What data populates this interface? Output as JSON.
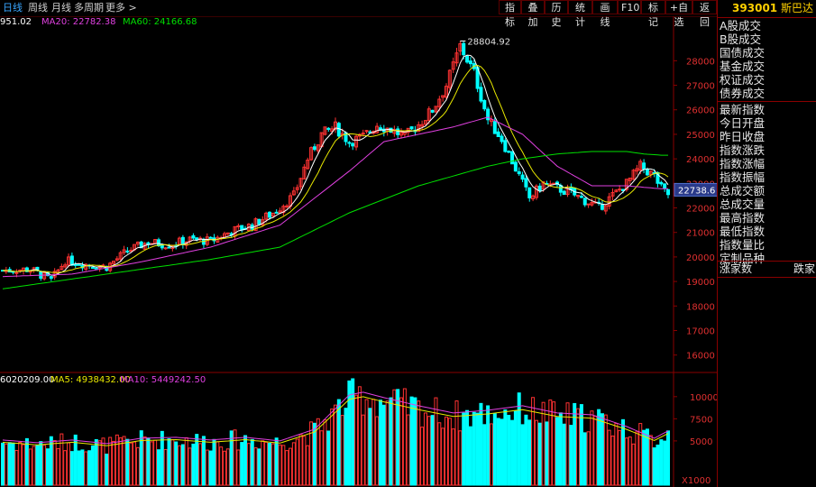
{
  "toolbar": {
    "periods": [
      "日线",
      "周线",
      "月线",
      "多周期",
      "更多 >"
    ],
    "tools": [
      "指标",
      "叠加",
      "历史",
      "统计",
      "画线",
      "F10",
      "标记",
      "+自选",
      "返回"
    ]
  },
  "indicators": {
    "price_line": [
      {
        "label": "951.02",
        "color": "#ffffff"
      },
      {
        "label": "MA20: 22782.38",
        "color": "#e040e0"
      },
      {
        "label": "MA60: 24166.68",
        "color": "#00e000"
      }
    ],
    "volume_line": [
      {
        "label": "6020209.00",
        "color": "#ffffff"
      },
      {
        "label": "MA5: 4938432.00",
        "color": "#e8e800"
      },
      {
        "label": "MA10: 5449242.50",
        "color": "#e040e0"
      }
    ]
  },
  "right_panel": {
    "code": "393001",
    "name": "斯巴达",
    "items_group1": [
      "A股成交",
      "B股成交",
      "国债成交",
      "基金成交",
      "权证成交",
      "债券成交"
    ],
    "items_group2": [
      "最新指数",
      "今日开盘",
      "昨日收盘",
      "指数涨跌",
      "指数涨幅",
      "指数振幅",
      "总成交额",
      "总成交量",
      "最高指数",
      "最低指数",
      "指数量比",
      "定制品种"
    ],
    "footer_left": "涨家数",
    "footer_right": "跌家"
  },
  "colors": {
    "up": "#ff3232",
    "down": "#00ffff",
    "ma5": "#ffffff",
    "ma10": "#e8e800",
    "ma20": "#e040e0",
    "ma60": "#00e000",
    "axis": "#8a0000",
    "accent": "#38a6ff"
  },
  "chart_data": [
    {
      "type": "candlestick",
      "title": "",
      "y_ticks": [
        16000,
        17000,
        18000,
        19000,
        20000,
        21000,
        22000,
        23000,
        24000,
        25000,
        26000,
        27000,
        28000
      ],
      "ylim": [
        15400,
        29300
      ],
      "annotations": [
        {
          "label": "28804.92",
          "value": 28804.92
        }
      ],
      "current_value_label": "22738.6",
      "current_value": 22738.6,
      "trend_path": [
        [
          0,
          19450
        ],
        [
          8,
          19500
        ],
        [
          14,
          19050
        ],
        [
          18,
          19850
        ],
        [
          24,
          19700
        ],
        [
          30,
          19600
        ],
        [
          36,
          20250
        ],
        [
          42,
          20600
        ],
        [
          48,
          20500
        ],
        [
          54,
          20700
        ],
        [
          60,
          20650
        ],
        [
          66,
          21050
        ],
        [
          72,
          21300
        ],
        [
          78,
          21800
        ],
        [
          84,
          22500
        ],
        [
          88,
          24000
        ],
        [
          92,
          25000
        ],
        [
          96,
          25300
        ],
        [
          100,
          24700
        ],
        [
          104,
          24900
        ],
        [
          108,
          25400
        ],
        [
          112,
          25200
        ],
        [
          116,
          24900
        ],
        [
          120,
          25400
        ],
        [
          124,
          26000
        ],
        [
          128,
          27000
        ],
        [
          132,
          28600
        ],
        [
          136,
          27500
        ],
        [
          140,
          25600
        ],
        [
          144,
          24800
        ],
        [
          148,
          23600
        ],
        [
          152,
          22400
        ],
        [
          156,
          23000
        ],
        [
          160,
          22800
        ],
        [
          164,
          22600
        ],
        [
          168,
          22300
        ],
        [
          172,
          22000
        ],
        [
          176,
          22500
        ],
        [
          180,
          23000
        ],
        [
          184,
          23700
        ],
        [
          188,
          23300
        ],
        [
          190,
          22800
        ],
        [
          192,
          22550
        ]
      ],
      "ma60_path": [
        [
          0,
          18700
        ],
        [
          30,
          19300
        ],
        [
          60,
          19900
        ],
        [
          80,
          20400
        ],
        [
          100,
          21800
        ],
        [
          120,
          22900
        ],
        [
          130,
          23300
        ],
        [
          140,
          23700
        ],
        [
          150,
          24000
        ],
        [
          160,
          24200
        ],
        [
          170,
          24300
        ],
        [
          180,
          24300
        ],
        [
          185,
          24200
        ],
        [
          190,
          24150
        ]
      ],
      "ma20_path": [
        [
          0,
          19200
        ],
        [
          20,
          19300
        ],
        [
          40,
          19800
        ],
        [
          60,
          20400
        ],
        [
          80,
          21300
        ],
        [
          100,
          23500
        ],
        [
          110,
          24700
        ],
        [
          120,
          25000
        ],
        [
          130,
          25300
        ],
        [
          140,
          25700
        ],
        [
          150,
          25000
        ],
        [
          160,
          23700
        ],
        [
          170,
          22900
        ],
        [
          180,
          22900
        ],
        [
          190,
          22780
        ]
      ]
    },
    {
      "type": "bar",
      "title": "",
      "y_ticks": [
        5000,
        7500,
        10000
      ],
      "ylim": [
        0,
        11000
      ],
      "unit_label": "X1000",
      "volume_path": [
        [
          0,
          5000
        ],
        [
          10,
          4700
        ],
        [
          20,
          5000
        ],
        [
          30,
          4600
        ],
        [
          40,
          5200
        ],
        [
          50,
          5300
        ],
        [
          60,
          5000
        ],
        [
          70,
          5300
        ],
        [
          80,
          4900
        ],
        [
          90,
          6200
        ],
        [
          100,
          10000
        ],
        [
          104,
          10300
        ],
        [
          110,
          9700
        ],
        [
          120,
          8800
        ],
        [
          130,
          8000
        ],
        [
          140,
          8300
        ],
        [
          150,
          8800
        ],
        [
          160,
          8000
        ],
        [
          170,
          7800
        ],
        [
          180,
          6500
        ],
        [
          188,
          5200
        ],
        [
          192,
          6020
        ]
      ]
    }
  ]
}
